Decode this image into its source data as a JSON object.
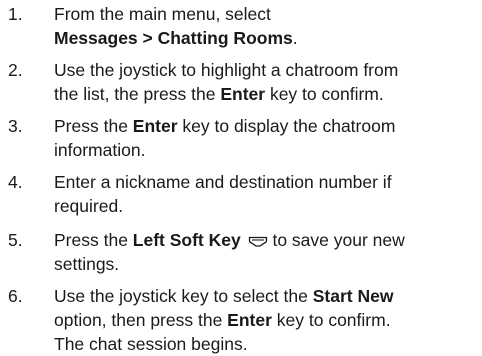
{
  "steps": [
    {
      "number": "1.",
      "lines": [
        [
          {
            "t": "From the main menu, select"
          }
        ],
        [
          {
            "t": "Messages > Chatting Rooms",
            "b": true
          },
          {
            "t": "."
          }
        ]
      ]
    },
    {
      "number": "2.",
      "lines": [
        [
          {
            "t": "Use the joystick to highlight a chatroom from"
          }
        ],
        [
          {
            "t": "the list, the press the "
          },
          {
            "t": "Enter",
            "b": true
          },
          {
            "t": " key to confirm."
          }
        ]
      ]
    },
    {
      "number": "3.",
      "lines": [
        [
          {
            "t": "Press the "
          },
          {
            "t": "Enter",
            "b": true
          },
          {
            "t": " key to display the chatroom"
          }
        ],
        [
          {
            "t": "information."
          }
        ]
      ]
    },
    {
      "number": "4.",
      "lines": [
        [
          {
            "t": "Enter a nickname and destination number if"
          }
        ],
        [
          {
            "t": "required."
          }
        ]
      ]
    },
    {
      "number": "5.",
      "lines": [
        [
          {
            "t": "Press the "
          },
          {
            "t": "Left Soft Key",
            "b": true
          },
          {
            "t": " "
          },
          {
            "icon": "left-soft-key-icon"
          },
          {
            "t": " to save your new"
          }
        ],
        [
          {
            "t": "settings."
          }
        ]
      ]
    },
    {
      "number": "6.",
      "lines": [
        [
          {
            "t": "Use the joystick key to select the "
          },
          {
            "t": "Start New",
            "b": true
          }
        ],
        [
          {
            "t": "option, then press the "
          },
          {
            "t": "Enter",
            "b": true
          },
          {
            "t": " key to confirm."
          }
        ],
        [
          {
            "t": "The chat session begins."
          }
        ]
      ]
    }
  ]
}
